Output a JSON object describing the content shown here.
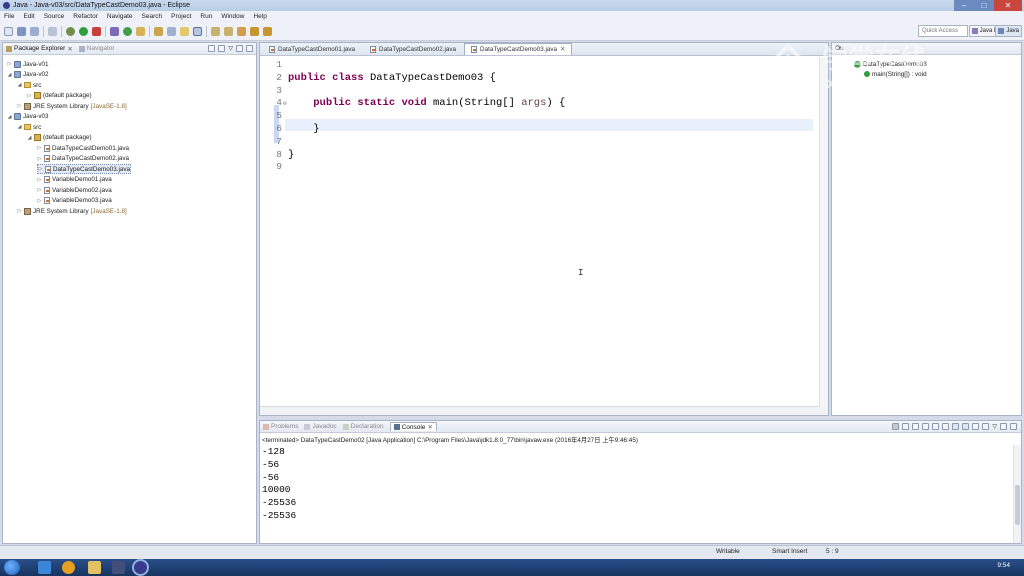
{
  "window": {
    "title": "Java - Java-v03/src/DataTypeCastDemo03.java - Eclipse",
    "controls": [
      "–",
      "□",
      "✕"
    ]
  },
  "menu": [
    "File",
    "Edit",
    "Source",
    "Refactor",
    "Navigate",
    "Search",
    "Project",
    "Run",
    "Window",
    "Help"
  ],
  "toolbar": {
    "quick_access_placeholder": "Quick Access",
    "perspectives": [
      "Java EE",
      "Java"
    ]
  },
  "package_explorer": {
    "tabs": [
      "Package Explorer",
      "Navigator"
    ],
    "tree": [
      {
        "label": "Java-v01",
        "type": "project",
        "depth": 0,
        "expanded": false
      },
      {
        "label": "Java-v02",
        "type": "project",
        "depth": 0,
        "expanded": true
      },
      {
        "label": "src",
        "type": "src",
        "depth": 1,
        "expanded": true
      },
      {
        "label": "(default package)",
        "type": "package",
        "depth": 2,
        "expanded": false
      },
      {
        "label": "JRE System Library",
        "suffix": "[JavaSE-1.8]",
        "type": "lib",
        "depth": 1,
        "expanded": false
      },
      {
        "label": "Java-v03",
        "type": "project",
        "depth": 0,
        "expanded": true
      },
      {
        "label": "src",
        "type": "src",
        "depth": 1,
        "expanded": true
      },
      {
        "label": "(default package)",
        "type": "package",
        "depth": 2,
        "expanded": true
      },
      {
        "label": "DataTypeCastDemo01.java",
        "type": "java",
        "depth": 3,
        "expanded": false
      },
      {
        "label": "DataTypeCastDemo02.java",
        "type": "java",
        "depth": 3,
        "expanded": false
      },
      {
        "label": "DataTypeCastDemo03.java",
        "type": "java",
        "depth": 3,
        "expanded": false,
        "selected": true
      },
      {
        "label": "VariableDemo01.java",
        "type": "java",
        "depth": 3,
        "expanded": false
      },
      {
        "label": "VariableDemo02.java",
        "type": "java",
        "depth": 3,
        "expanded": false
      },
      {
        "label": "VariableDemo03.java",
        "type": "java",
        "depth": 3,
        "expanded": false
      },
      {
        "label": "JRE System Library",
        "suffix": "[JavaSE-1.8]",
        "type": "lib",
        "depth": 1,
        "expanded": false
      }
    ]
  },
  "editor": {
    "tabs": [
      {
        "label": "DataTypeCastDemo01.java",
        "active": false
      },
      {
        "label": "DataTypeCastDemo02.java",
        "active": false
      },
      {
        "label": "DataTypeCastDemo03.java",
        "active": true
      }
    ],
    "lines": [
      {
        "n": "1",
        "tokens": []
      },
      {
        "n": "2",
        "tokens": [
          {
            "t": "public",
            "k": true
          },
          {
            "t": " "
          },
          {
            "t": "class",
            "k": true
          },
          {
            "t": " DataTypeCastDemo03 {"
          }
        ]
      },
      {
        "n": "3",
        "tokens": []
      },
      {
        "n": "4",
        "tokens": [
          {
            "t": "    "
          },
          {
            "t": "public",
            "k": true
          },
          {
            "t": " "
          },
          {
            "t": "static",
            "k": true
          },
          {
            "t": " "
          },
          {
            "t": "void",
            "k": true
          },
          {
            "t": " main(String[] "
          },
          {
            "t": "args",
            "p": true
          },
          {
            "t": ") {"
          }
        ]
      },
      {
        "n": "5",
        "tokens": []
      },
      {
        "n": "6",
        "tokens": [
          {
            "t": "    }"
          }
        ]
      },
      {
        "n": "7",
        "tokens": []
      },
      {
        "n": "8",
        "tokens": [
          {
            "t": "}"
          }
        ]
      },
      {
        "n": "9",
        "tokens": []
      }
    ]
  },
  "outline": {
    "tab": "Ou",
    "items": [
      "DataTypeCastDemo03",
      "main(String[]) : void"
    ]
  },
  "console": {
    "tabs": [
      "Problems",
      "Javadoc",
      "Declaration",
      "Console"
    ],
    "header": "<terminated> DataTypeCastDemo02 [Java Application] C:\\Program Files\\Java\\jdk1.8.0_77\\bin\\javaw.exe (2016年4月27日 上午9:46:45)",
    "output": [
      "-128",
      "-56",
      "-56",
      "10000",
      "-25536",
      "-25536"
    ]
  },
  "status": {
    "writable": "Writable",
    "insert_mode": "Smart Insert",
    "position": "5 : 9"
  },
  "taskbar": {
    "time": "9:54"
  },
  "watermark": {
    "text_cn": "学堂在线",
    "text_en": "xuetangx.com"
  }
}
